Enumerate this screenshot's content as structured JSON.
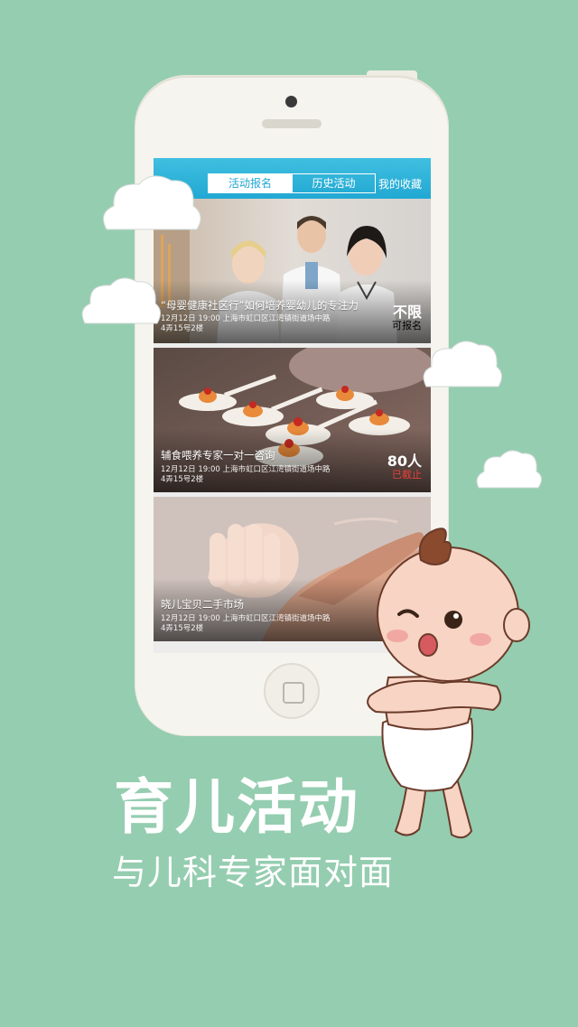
{
  "tabs": [
    {
      "label": "活动报名",
      "active": true
    },
    {
      "label": "历史活动",
      "active": false
    }
  ],
  "favorites_label": "我的收藏",
  "events": [
    {
      "title": "“母婴健康社区行”如何培养婴幼儿的专注力",
      "meta_line1": "12月12日  19:00  上海市虹口区江湾镇街道场中路",
      "meta_line2": "4弄15号2楼",
      "count": "不限",
      "status": "可报名",
      "status_color": "#ffffff",
      "image": "doctors-photo"
    },
    {
      "title": "辅食喂养专家一对一咨询",
      "meta_line1": "12月12日  19:00  上海市虹口区江湾镇街道场中路",
      "meta_line2": "4弄15号2楼",
      "count": "80人",
      "status": "已截止",
      "status_color": "#e8413c",
      "image": "food-spoons-photo"
    },
    {
      "title": "晓儿宝贝二手市场",
      "meta_line1": "12月12日  19:00  上海市虹口区江湾镇街道场中路",
      "meta_line2": "4弄15号2楼",
      "count": "",
      "status": "",
      "status_color": "#ffffff",
      "image": "baby-hand-photo"
    }
  ],
  "headline": "育儿活动",
  "subheadline": "与儿科专家面对面",
  "colors": {
    "background": "#95cdb0",
    "accent_blue": "#22a7d2",
    "closed_red": "#e8413c"
  }
}
